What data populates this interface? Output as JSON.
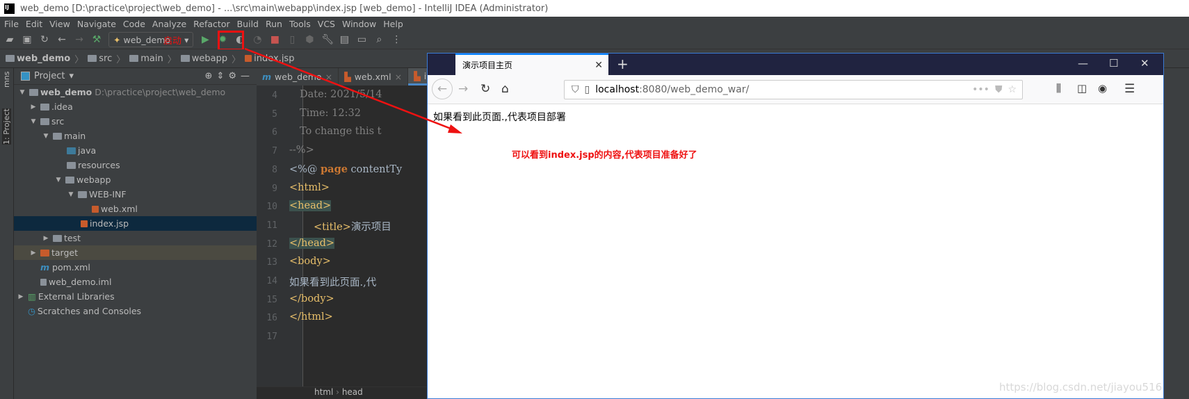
{
  "window": {
    "title": "web_demo [D:\\practice\\project\\web_demo] - ...\\src\\main\\webapp\\index.jsp [web_demo] - IntelliJ IDEA (Administrator)",
    "logo": "IJ"
  },
  "menu": [
    "File",
    "Edit",
    "View",
    "Navigate",
    "Code",
    "Analyze",
    "Refactor",
    "Build",
    "Run",
    "Tools",
    "VCS",
    "Window",
    "Help"
  ],
  "toolbar": {
    "run_config": "web_demo",
    "annotation": "启动"
  },
  "breadcrumb": [
    "web_demo",
    "src",
    "main",
    "webapp",
    "index.jsp"
  ],
  "side_strip": {
    "top": "mns",
    "project": "1: Project"
  },
  "project": {
    "header": "Project",
    "root": "web_demo",
    "root_path": "D:\\practice\\project\\web_demo",
    "items": [
      ".idea",
      "src",
      "main",
      "java",
      "resources",
      "webapp",
      "WEB-INF",
      "web.xml",
      "index.jsp",
      "test",
      "target",
      "pom.xml",
      "web_demo.iml",
      "External Libraries",
      "Scratches and Consoles"
    ]
  },
  "editor": {
    "tabs": [
      "web_demo",
      "web.xml",
      "in"
    ],
    "lines": [
      "4",
      "5",
      "6",
      "7",
      "8",
      "9",
      "10",
      "11",
      "12",
      "13",
      "14",
      "15",
      "16",
      "17"
    ],
    "code": {
      "l4": "Date: 2021/5/14",
      "l5": "Time: 12:32",
      "l6": "To change this t",
      "l7": "--%>",
      "l8a": "<%@ ",
      "l8b": "page",
      "l8c": " contentTy",
      "l9": "<html>",
      "l10": "<head>",
      "l11a": "<title>",
      "l11b": "演示项目",
      "l12": "</head>",
      "l13": "<body>",
      "l14": "如果看到此页面.,代",
      "l15": "</body>",
      "l16": "</html>"
    },
    "status": [
      "html",
      "head"
    ]
  },
  "browser": {
    "tab_title": "演示项目主页",
    "url_host": "localhost",
    "url_path": ":8080/web_demo_war/",
    "page_text": "如果看到此页面.,代表项目部署"
  },
  "annotation": "可以看到index.jsp的内容,代表项目准备好了",
  "watermark": "https://blog.csdn.net/jiayou516",
  "colors": {
    "annotation": "#ee1111",
    "selection": "#0d293e",
    "browser_tabbar": "#202340"
  }
}
